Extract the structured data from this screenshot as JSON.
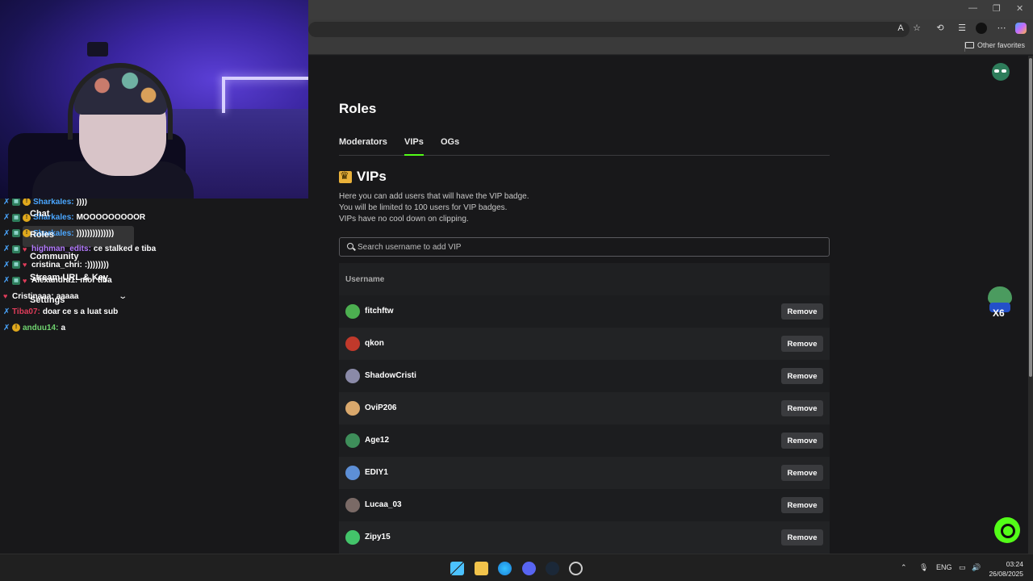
{
  "browser": {
    "favorites_other": "Other favorites",
    "window_controls": [
      "—",
      "❐",
      "✕"
    ],
    "toolbar_icons": [
      "read-aloud-icon",
      "star-icon",
      "extensions-icon",
      "favorites-icon",
      "profile-icon",
      "more-icon",
      "copilot-icon"
    ]
  },
  "chat": {
    "messages": [
      {
        "user": "Sharkales:",
        "text": "))))",
        "user_color": "#4aa6ff",
        "badges": [
          "sword",
          "grid",
          "sub"
        ]
      },
      {
        "user": "Sharkales:",
        "text": "MOOOOOOOOOR",
        "user_color": "#4aa6ff",
        "badges": [
          "sword",
          "grid",
          "sub"
        ]
      },
      {
        "user": "Sharkales:",
        "text": "))))))))))))))",
        "user_color": "#4aa6ff",
        "badges": [
          "sword",
          "grid",
          "sub"
        ]
      },
      {
        "user": "highman_edits:",
        "text": "ce stalked e tiba",
        "user_color": "#b57bff",
        "badges": [
          "sword",
          "grid",
          "heart"
        ]
      },
      {
        "user": "cristina_chri:",
        "text": ":))))))))",
        "user_color": "#ffffff",
        "badges": [
          "sword",
          "grid",
          "heart"
        ]
      },
      {
        "user": "Alexandra1:",
        "text": "mor tiba",
        "user_color": "#ffffff",
        "badges": [
          "sword",
          "grid",
          "heart"
        ]
      },
      {
        "user": "Cristinaaa:",
        "text": "aaaaa",
        "user_color": "#ffffff",
        "badges": [
          "heart"
        ]
      },
      {
        "user": "Tiba07:",
        "text": "doar ce s a luat sub",
        "user_color": "#e03c5a",
        "badges": [
          "sword"
        ]
      },
      {
        "user": "anduu14:",
        "text": "a",
        "user_color": "#6fd36f",
        "badges": [
          "sword",
          "sub"
        ]
      }
    ],
    "menu": [
      "Chat",
      "Roles",
      "Community",
      "Stream URL & Key",
      "Settings"
    ]
  },
  "page": {
    "title": "Roles",
    "tabs": [
      "Moderators",
      "VIPs",
      "OGs"
    ],
    "active_tab": "VIPs",
    "section_title": "VIPs",
    "description": [
      "Here you can add users that will have the VIP badge.",
      "You will be limited to 100 users for VIP badges.",
      "VIPs have no cool down on clipping."
    ],
    "search_placeholder": "Search username to add VIP",
    "table_header": "Username",
    "remove_label": "Remove",
    "users": [
      {
        "name": "fitchftw",
        "color": "#4caf50"
      },
      {
        "name": "qkon",
        "color": "#c0392b"
      },
      {
        "name": "ShadowCristi",
        "color": "#8a8aa8"
      },
      {
        "name": "OviP206",
        "color": "#d9a86c"
      },
      {
        "name": "Age12",
        "color": "#3e8e5a"
      },
      {
        "name": "EDIY1",
        "color": "#5d8fd6"
      },
      {
        "name": "Lucaa_03",
        "color": "#7a6a66"
      },
      {
        "name": "Zipy15",
        "color": "#43c46a"
      }
    ],
    "sticker_label": "X6",
    "accent": "#53fc18"
  },
  "taskbar": {
    "tray_lang": "ENG",
    "time": "03:24",
    "date": "26/08/2025"
  }
}
